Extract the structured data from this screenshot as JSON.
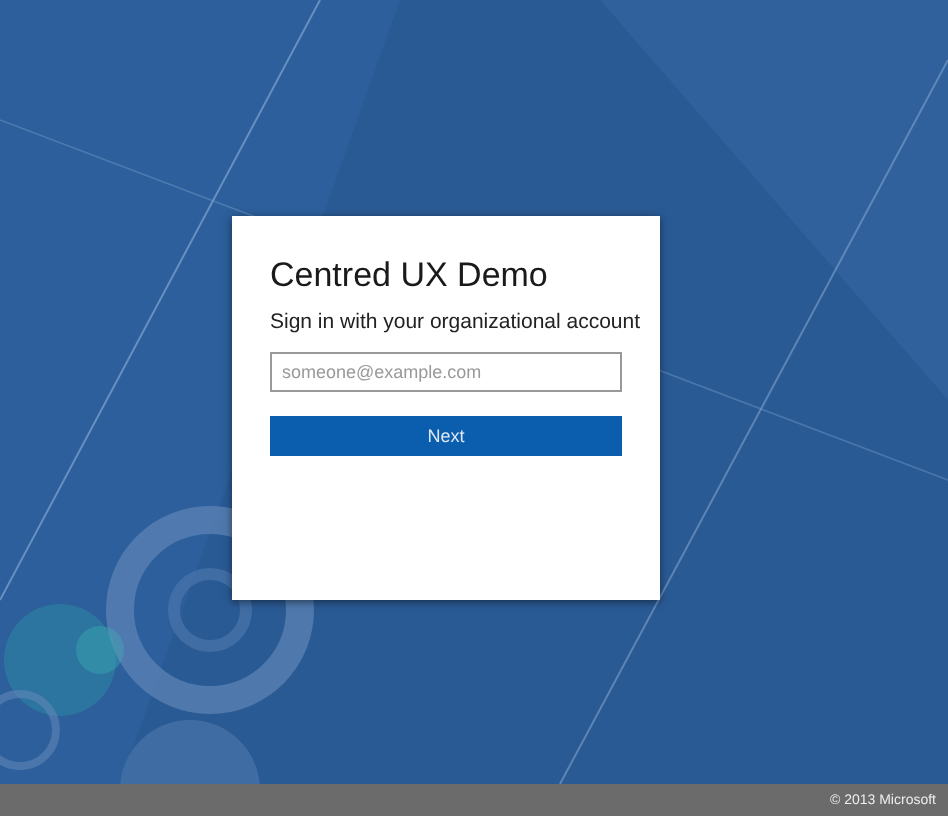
{
  "dialog": {
    "title": "Centred UX Demo",
    "subtitle": "Sign in with your organizational account"
  },
  "email_field": {
    "placeholder": "someone@example.com"
  },
  "buttons": [
    {
      "label": "Next",
      "kind": "primary"
    }
  ],
  "footer": {
    "copyright": "© 2013 Microsoft"
  }
}
